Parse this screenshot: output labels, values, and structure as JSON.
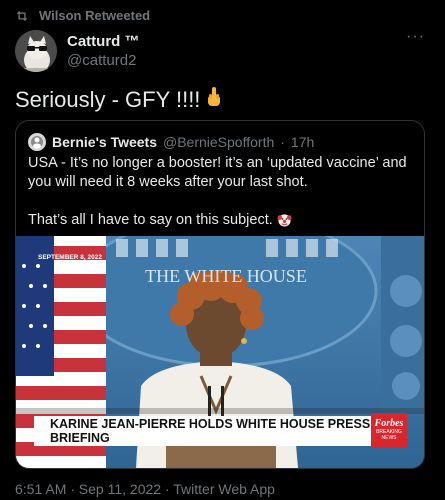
{
  "retweet": {
    "label": "Wilson Retweeted"
  },
  "author": {
    "display_name": "Catturd ™",
    "handle": "@catturd2"
  },
  "tweet": {
    "text": "Seriously - GFY !!!!"
  },
  "quoted": {
    "name": "Bernie's Tweets",
    "handle": "@BernieSpofforth",
    "separator": "·",
    "age": "17h",
    "paragraph1": "USA - It’s no longer a booster! it’s an ‘updated vaccine’ and you will need it 8 weeks after your last shot.",
    "paragraph2": "That’s all I have to say on this subject."
  },
  "media": {
    "date": "SEPTEMBER 8, 2022",
    "chyron": "KARINE JEAN-PIERRE HOLDS WHITE HOUSE PRESS BRIEFING",
    "badge_name": "Forbes",
    "badge_sub": "BREAKING NEWS",
    "backdrop_text": "THE WHITE HOUSE"
  },
  "footer": {
    "timestamp": "6:51 AM · Sep 11, 2022 · Twitter Web App"
  },
  "icons": [
    "retweet-icon",
    "more-icon",
    "middle-finger-emoji",
    "clown-emoji"
  ]
}
